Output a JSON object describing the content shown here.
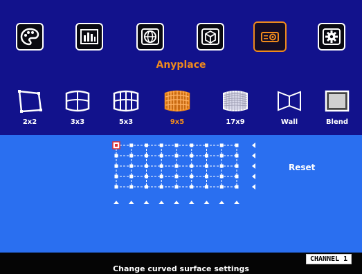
{
  "top_menu": [
    {
      "name": "palette-icon",
      "selected": false
    },
    {
      "name": "equalizer-icon",
      "selected": false
    },
    {
      "name": "globe-icon",
      "selected": false
    },
    {
      "name": "3d-box-icon",
      "selected": false
    },
    {
      "name": "projector-icon",
      "selected": true
    },
    {
      "name": "settings-gear-icon",
      "selected": false
    }
  ],
  "mode_label": "Anyplace",
  "options": [
    {
      "label": "2x2",
      "icon": "quad-warp-icon",
      "selected": false
    },
    {
      "label": "3x3",
      "icon": "curved-grid-3x3-icon",
      "selected": false
    },
    {
      "label": "5x3",
      "icon": "curved-grid-5x3-icon",
      "selected": false
    },
    {
      "label": "9x5",
      "icon": "curved-grid-9x5-icon",
      "selected": true
    },
    {
      "label": "17x9",
      "icon": "curved-grid-17x9-icon",
      "selected": false
    },
    {
      "label": "Wall",
      "icon": "corner-wall-icon",
      "selected": false
    },
    {
      "label": "Blend",
      "icon": "blend-screen-icon",
      "selected": false
    }
  ],
  "grid": {
    "columns": 9,
    "rows": 5,
    "selected_point": [
      0,
      0
    ]
  },
  "reset_label": "Reset",
  "hint": "Change curved surface settings",
  "channel": "CHANNEL 1",
  "colors": {
    "menu_bg": "#12128c",
    "grid_bg": "#2a6ff0",
    "accent": "#f08a1c",
    "text": "#ffffff"
  }
}
